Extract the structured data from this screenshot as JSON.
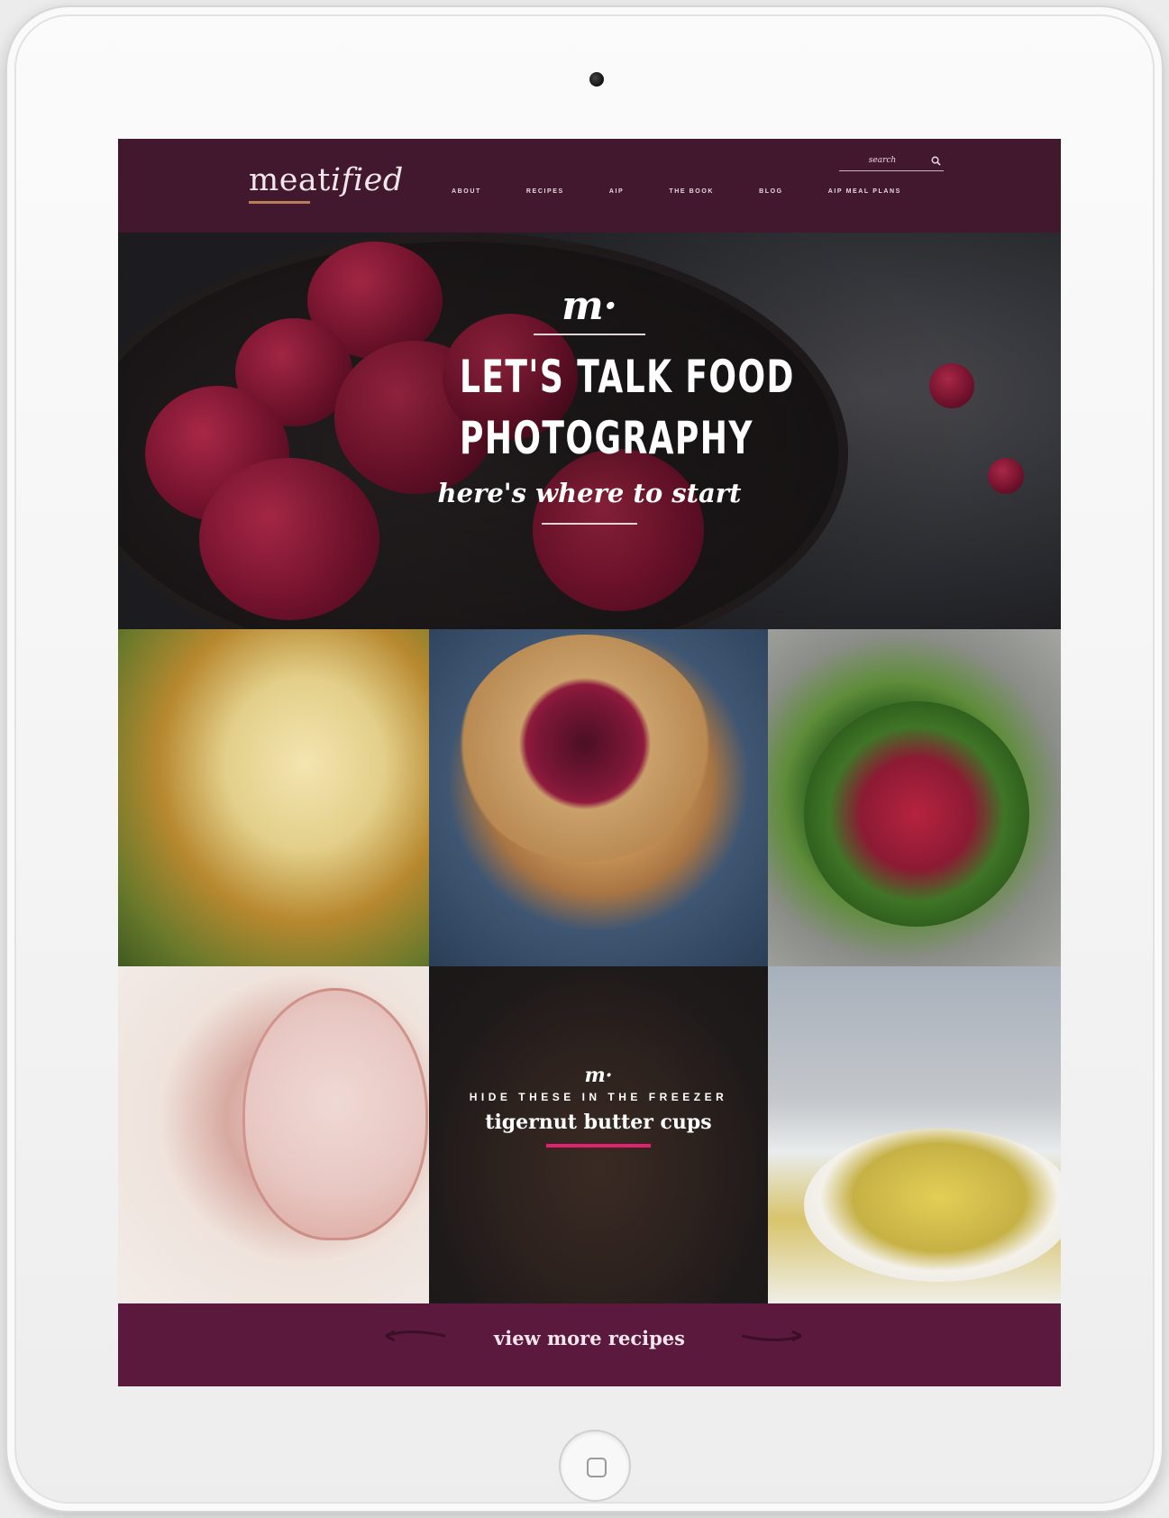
{
  "header": {
    "logo": {
      "word_main": "meat",
      "word_script": "ified"
    },
    "search": {
      "placeholder": "search"
    },
    "nav": [
      {
        "label": "ABOUT"
      },
      {
        "label": "RECIPES"
      },
      {
        "label": "AIP"
      },
      {
        "label": "THE BOOK"
      },
      {
        "label": "BLOG"
      },
      {
        "label": "AIP MEAL PLANS"
      }
    ]
  },
  "hero": {
    "mark": "m·",
    "title_line1": "LET'S TALK FOOD",
    "title_line2": "PHOTOGRAPHY",
    "subtitle": "here's where to start"
  },
  "promo": {
    "mark": "m·",
    "kicker": "HIDE THESE IN THE FREEZER",
    "title": "tigernut butter cups"
  },
  "footer": {
    "view_more": "view more recipes"
  },
  "colors": {
    "header_bg": "#42182e",
    "bar_bg": "#5b1a3d",
    "accent_link": "#e2216f",
    "logo_subtitle": "#d49a5f"
  },
  "icons": {
    "search": "magnifier-icon",
    "camera": "camera-dot",
    "home": "home-button-square"
  }
}
